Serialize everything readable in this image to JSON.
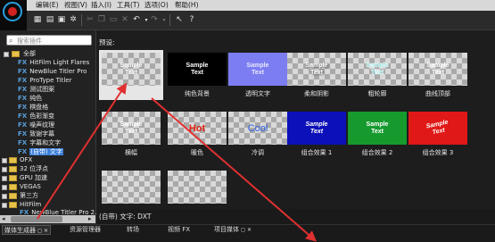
{
  "menubar": {
    "items": [
      "编辑(E)",
      "视图(V)",
      "插入(I)",
      "工具(T)",
      "选项(O)",
      "帮助(H)"
    ]
  },
  "search": {
    "placeholder": "搜索插件"
  },
  "tree": {
    "root": "全部",
    "fx_prefix": "FX",
    "children": [
      "HitFilm Light Flares",
      "NewBlue Titler Pro",
      "ProType Titler",
      "测试图案",
      "纯色",
      "棋盘格",
      "色彩渐变",
      "噪声纹理",
      "致谢字幕",
      "字幕和文字",
      "(自带) 文字"
    ],
    "selected_index": 10,
    "groups": [
      "OFX",
      "32 位浮点",
      "GPU 加速",
      "VEGAS",
      "第三方",
      "HitFilm",
      "NewBlue Titler Pro 2.0"
    ]
  },
  "presets": {
    "label": "预设:",
    "rows": [
      [
        {
          "caption": "",
          "text": [
            "Sample",
            "Text"
          ],
          "selected": true
        },
        {
          "caption": "纯色背景",
          "text": [
            "Sample",
            "Text"
          ]
        },
        {
          "caption": "透明文字",
          "text": [
            "Sample",
            "Text"
          ]
        },
        {
          "caption": "柔和阴影",
          "text": [
            "Sample",
            "Text"
          ]
        },
        {
          "caption": "粗轮廓",
          "text": [
            "Sample",
            "Text"
          ]
        },
        {
          "caption": "曲线顶部",
          "text": [
            "Sample",
            "Text"
          ]
        }
      ],
      [
        {
          "caption": "横幅",
          "text": [
            "Sample",
            "Text"
          ]
        },
        {
          "caption": "暖色",
          "text": [
            "Hot"
          ]
        },
        {
          "caption": "冷调",
          "text": [
            "Cool"
          ]
        },
        {
          "caption": "组合效果 1",
          "text": [
            "Sample",
            "Text"
          ]
        },
        {
          "caption": "组合效果 2",
          "text": [
            "Sample",
            "Text"
          ]
        },
        {
          "caption": "组合效果 3",
          "text": [
            "Sample",
            "Text"
          ]
        }
      ],
      [
        {
          "caption": "",
          "text": []
        },
        {
          "caption": "",
          "text": []
        }
      ]
    ]
  },
  "status_caption": "(自带) 文字: DXT",
  "tabs": [
    "媒体生成器",
    "资源管理器",
    "转场",
    "视频 FX",
    "项目媒体"
  ],
  "colors": {
    "accent": "#3d7fd8",
    "arrow": "#e03030",
    "fx_blue": "#58a0dc"
  },
  "icons": [
    "app-logo-icon",
    "new-icon",
    "open-icon",
    "save-icon",
    "settings-icon",
    "cut-icon",
    "copy-icon",
    "paste-icon",
    "delete-icon",
    "undo-icon",
    "redo-icon",
    "pointer-icon",
    "help-icon"
  ]
}
